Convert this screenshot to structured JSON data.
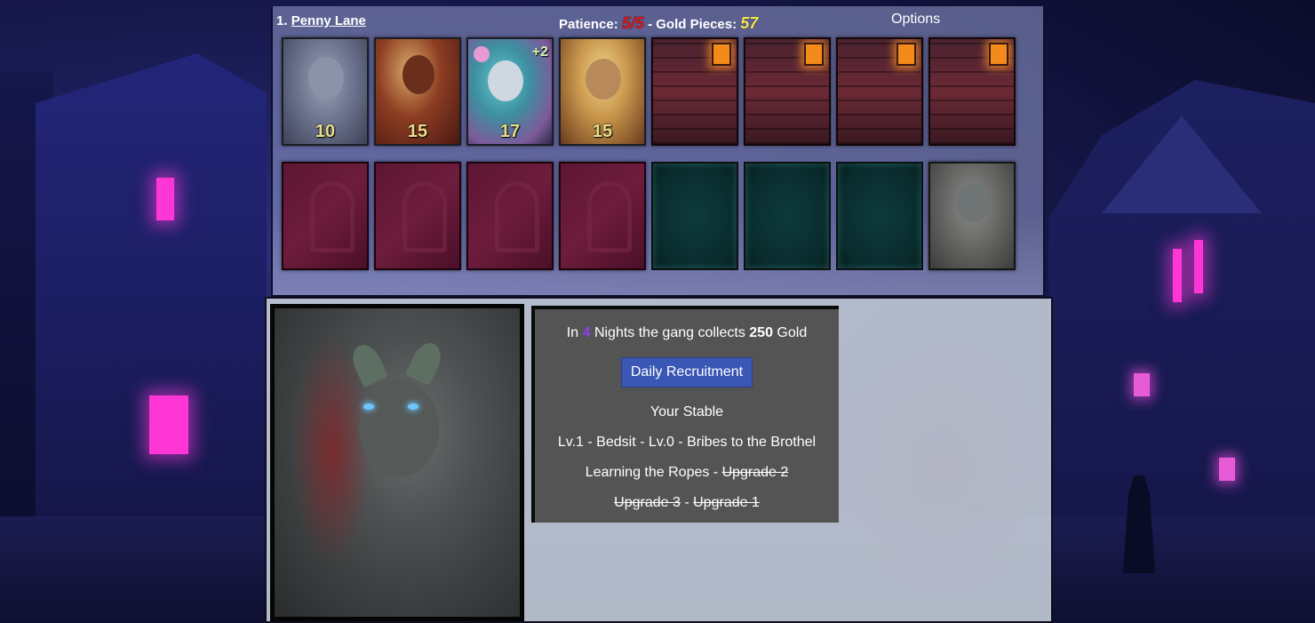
{
  "header": {
    "location_index": "1.",
    "location_name": "Penny Lane",
    "patience_label": "Patience:",
    "patience_value": "5/5",
    "separator": "-",
    "gold_label": "Gold Pieces:",
    "gold_value": "57",
    "options_label": "Options"
  },
  "row1": [
    {
      "kind": "girl",
      "level": "10",
      "bonus": ""
    },
    {
      "kind": "girl",
      "level": "15",
      "bonus": ""
    },
    {
      "kind": "girl",
      "level": "17",
      "bonus": "+2"
    },
    {
      "kind": "girl",
      "level": "15",
      "bonus": ""
    },
    {
      "kind": "locked-room"
    },
    {
      "kind": "locked-room"
    },
    {
      "kind": "locked-room"
    },
    {
      "kind": "locked-room"
    }
  ],
  "row2": [
    {
      "kind": "maroon-slot"
    },
    {
      "kind": "maroon-slot"
    },
    {
      "kind": "maroon-slot"
    },
    {
      "kind": "maroon-slot"
    },
    {
      "kind": "teal-slot"
    },
    {
      "kind": "teal-slot"
    },
    {
      "kind": "teal-slot"
    },
    {
      "kind": "fog-portrait"
    }
  ],
  "info": {
    "gang_prefix": "In",
    "gang_nights": "4",
    "gang_middle": "Nights the gang collects",
    "gang_gold": "250",
    "gang_suffix": "Gold",
    "recruit_button": "Daily Recruitment",
    "stable_title": "Your Stable",
    "stable_line": "Lv.1 - Bedsit - Lv.0 - Bribes to the Brothel",
    "ropes_label": "Learning the Ropes",
    "upgrade2": "Upgrade 2",
    "upgrade3": "Upgrade 3",
    "upgrade1": "Upgrade 1",
    "dash": " - "
  },
  "colors": {
    "patience": "#d8161b",
    "gold": "#f4e65a",
    "nights": "#8a3ff0",
    "recruit_button": "#3a57b5"
  }
}
